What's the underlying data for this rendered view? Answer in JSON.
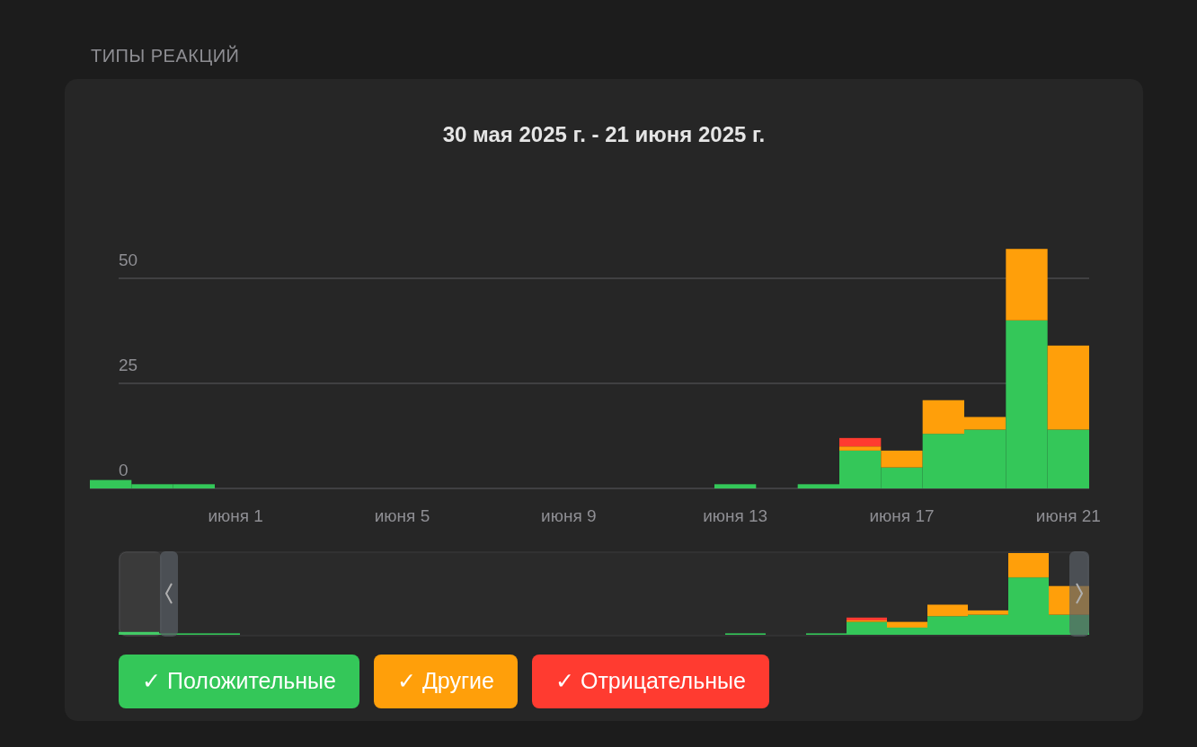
{
  "section_title": "ТИПЫ РЕАКЦИЙ",
  "card": {
    "title": "30 мая 2025 г. - 21 июня 2025 г.",
    "chart_data": {
      "type": "bar",
      "stacked": true,
      "categories": [
        null,
        null,
        null,
        "июня 1",
        null,
        null,
        null,
        "июня 5",
        null,
        null,
        null,
        "июня 9",
        null,
        null,
        null,
        "июня 13",
        null,
        null,
        null,
        "июня 17",
        null,
        null,
        null,
        "июня 21"
      ],
      "series": [
        {
          "name": "Положительные",
          "color": "#34c759",
          "values": [
            2,
            1,
            1,
            0,
            0,
            0,
            0,
            0,
            0,
            0,
            0,
            0,
            0,
            0,
            0,
            1,
            0,
            1,
            9,
            5,
            13,
            14,
            40,
            14
          ]
        },
        {
          "name": "Другие",
          "color": "#ff9f0a",
          "values": [
            0,
            0,
            0,
            0,
            0,
            0,
            0,
            0,
            0,
            0,
            0,
            0,
            0,
            0,
            0,
            0,
            0,
            0,
            1,
            4,
            8,
            3,
            17,
            20
          ]
        },
        {
          "name": "Отрицательные",
          "color": "#ff3b30",
          "values": [
            0,
            0,
            0,
            0,
            0,
            0,
            0,
            0,
            0,
            0,
            0,
            0,
            0,
            0,
            0,
            0,
            0,
            0,
            2,
            0,
            0,
            0,
            0,
            0
          ]
        }
      ],
      "ylim": [
        0,
        57
      ],
      "yticks": [
        0,
        25,
        50
      ]
    },
    "legend": [
      {
        "mark": "✓",
        "selected": true
      },
      {
        "mark": "✓",
        "selected": true
      },
      {
        "mark": "✓",
        "selected": true
      }
    ]
  }
}
